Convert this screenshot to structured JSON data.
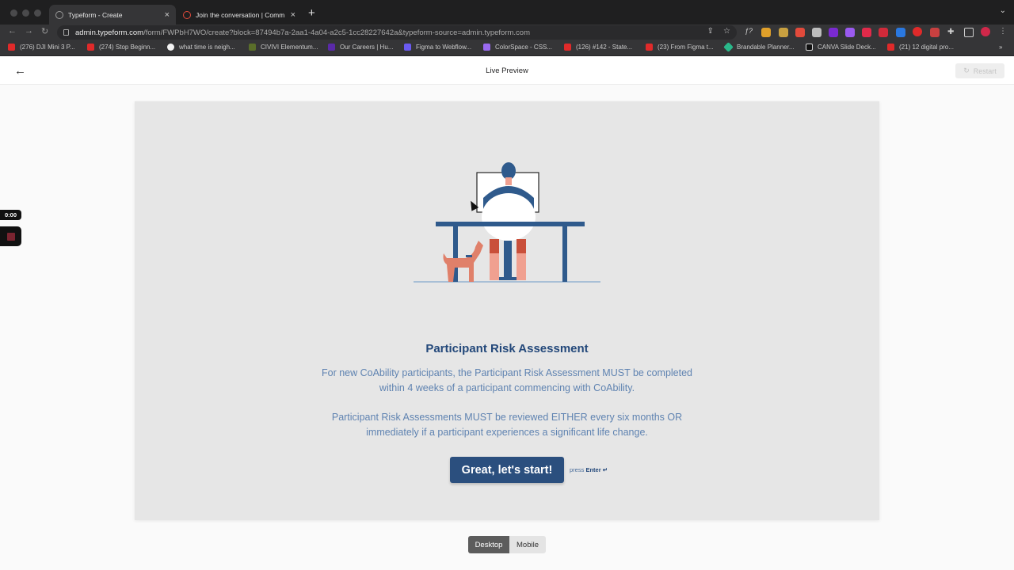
{
  "browser": {
    "tabs": [
      {
        "title": "Typeform - Create",
        "close": "×"
      },
      {
        "title": "Join the conversation | Comm",
        "close": "×"
      }
    ],
    "new_tab": "+",
    "url_host": "admin.typeform.com",
    "url_path": "/form/FWPbH7WO/create?block=87494b7a-2aa1-4a04-a2c5-1cc28227642a&typeform-source=admin.typeform.com",
    "bookmarks": [
      {
        "label": "(276) DJI Mini 3 P...",
        "color": "#e02a2a"
      },
      {
        "label": "(274) Stop Beginn...",
        "color": "#e02a2a"
      },
      {
        "label": "what time is neigh...",
        "color": "#f2f2f2"
      },
      {
        "label": "CIVIVI Elementum...",
        "color": "#5a6e2a"
      },
      {
        "label": "Our Careers | Hu...",
        "color": "#5a2aa8"
      },
      {
        "label": "Figma to Webflow...",
        "color": "#6a5af0"
      },
      {
        "label": "ColorSpace - CSS...",
        "color": "#9a6af0"
      },
      {
        "label": "(126) #142 - State...",
        "color": "#e02a2a"
      },
      {
        "label": "(23) From Figma t...",
        "color": "#e02a2a"
      },
      {
        "label": "Brandable Planner...",
        "color": "#2ab88a"
      },
      {
        "label": "CANVA Slide Deck...",
        "color": "#111111"
      },
      {
        "label": "(21) 12 digital pro...",
        "color": "#e02a2a"
      }
    ]
  },
  "header": {
    "title": "Live Preview",
    "restart_label": "Restart"
  },
  "recorder": {
    "time": "0:00"
  },
  "form": {
    "title": "Participant Risk Assessment",
    "paragraph_1": "For new CoAbility participants, the Participant Risk Assessment MUST be completed within 4 weeks of a participant commencing with CoAbility.",
    "paragraph_2": "Participant Risk Assessments MUST be reviewed EITHER every six months OR immediately if a participant experiences a significant life change.",
    "start_button": "Great, let's start!",
    "hint_press": "press",
    "hint_key": "Enter ↵"
  },
  "device_toggle": {
    "desktop": "Desktop",
    "mobile": "Mobile"
  },
  "colors": {
    "accent": "#2b4f7e",
    "title": "#23487a",
    "body_text": "#5f83b1",
    "card_bg": "#e6e6e6"
  }
}
